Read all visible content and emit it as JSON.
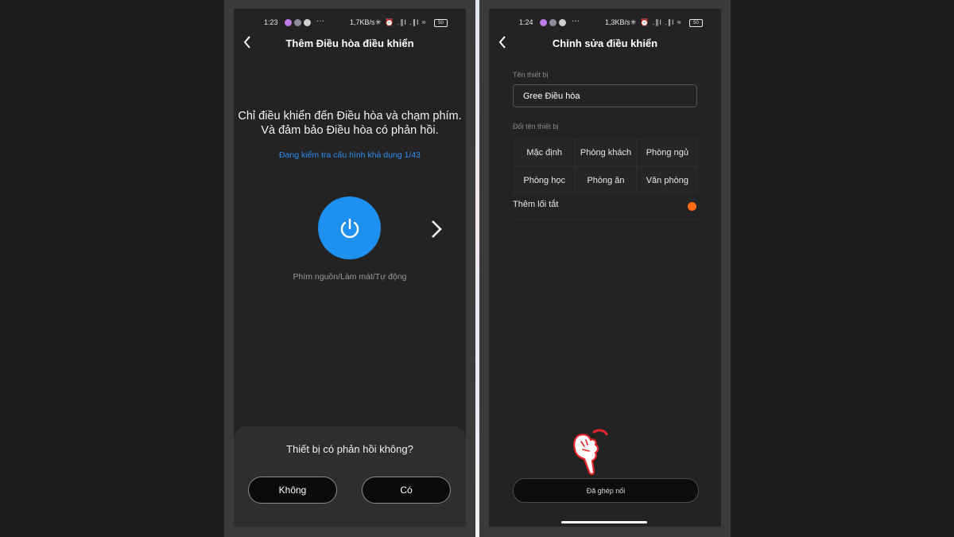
{
  "left_screen": {
    "status": {
      "time": "1:23",
      "net": "1,7KB/s",
      "more": "···",
      "signal_icons": "✳ ⏰ .∥l .∥l ≈",
      "battery": "50"
    },
    "title": "Thêm Điều hòa điều khiển",
    "instruction_line1": "Chỉ điều khiển đến Điều hòa và chạm phím.",
    "instruction_line2": "Và đảm bảo Điều hòa có phản hồi.",
    "checking_text": "Đang kiểm tra cấu hình khả dụng 1/43",
    "key_label": "Phím nguồn/Làm mát/Tự động",
    "sheet": {
      "question": "Thiết bị có phản hồi không?",
      "no_label": "Không",
      "yes_label": "Có"
    }
  },
  "right_screen": {
    "status": {
      "time": "1:24",
      "net": "1,3KB/s",
      "more": "···",
      "signal_icons": "✳ ⏰ .∥l .∥l ≈",
      "battery": "50"
    },
    "title": "Chỉnh sửa điều khiển",
    "device_name_label": "Tên thiết bị",
    "device_name_value": "Gree Điều hòa",
    "rename_label": "Đổi tên thiết bị",
    "rooms": [
      "Mặc định",
      "Phòng khách",
      "Phòng ngủ",
      "Phòng học",
      "Phòng ăn",
      "Văn phòng"
    ],
    "shortcut_label": "Thêm lối tắt",
    "paired_button": "Đã ghép nối"
  },
  "colors": {
    "accent_blue": "#1e90f0",
    "link_blue": "#2f8ff0",
    "toggle_orange": "#ff6a13",
    "screen_bg": "#232323"
  },
  "icons": [
    "back-arrow-icon",
    "power-icon",
    "chevron-right-icon",
    "pointing-hand-icon"
  ]
}
